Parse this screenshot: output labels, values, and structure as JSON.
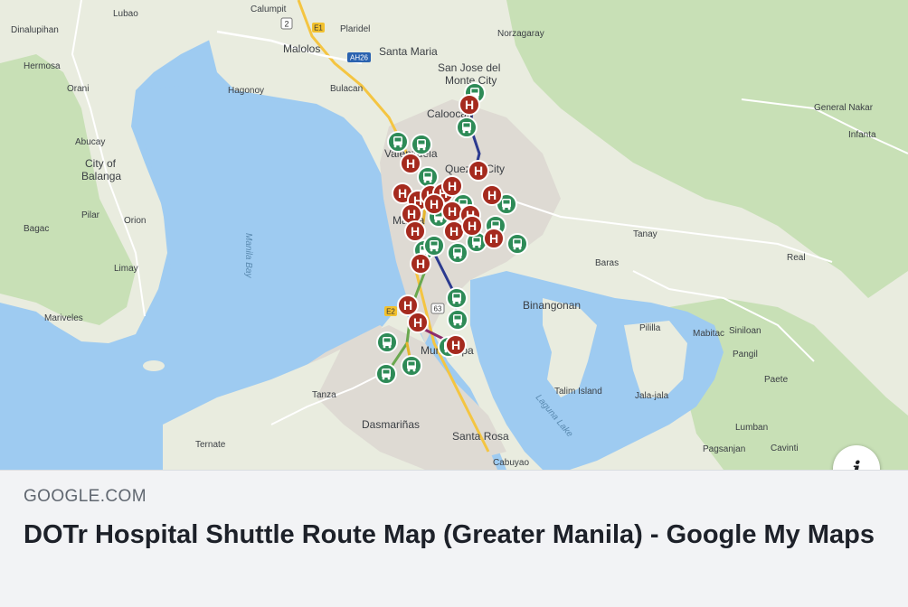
{
  "link_card": {
    "domain": "GOOGLE.COM",
    "title": "DOTr Hospital Shuttle Route Map (Greater Manila) - Google My Maps",
    "info_icon": "i"
  },
  "map": {
    "places": [
      {
        "id": "lubao",
        "label": "Lubao"
      },
      {
        "id": "calumpit",
        "label": "Calumpit"
      },
      {
        "id": "plaridel",
        "label": "Plaridel"
      },
      {
        "id": "norzagaray",
        "label": "Norzagaray"
      },
      {
        "id": "dinalupihan",
        "label": "Dinalupihan"
      },
      {
        "id": "malolos",
        "label": "Malolos"
      },
      {
        "id": "santa-maria",
        "label": "Santa Maria"
      },
      {
        "id": "hermosa",
        "label": "Hermosa"
      },
      {
        "id": "san-jose-del-monte",
        "label": "San Jose del"
      },
      {
        "id": "san-jose-del-monte-2",
        "label": "Monte City"
      },
      {
        "id": "orani",
        "label": "Orani"
      },
      {
        "id": "hagonoy",
        "label": "Hagonoy"
      },
      {
        "id": "bulacan",
        "label": "Bulacan"
      },
      {
        "id": "caloocan",
        "label": "Caloocan"
      },
      {
        "id": "general-nakar",
        "label": "General Nakar"
      },
      {
        "id": "infanta",
        "label": "Infanta"
      },
      {
        "id": "abucay",
        "label": "Abucay"
      },
      {
        "id": "city-of-balanga",
        "label": "City of"
      },
      {
        "id": "city-of-balanga-2",
        "label": "Balanga"
      },
      {
        "id": "valenzuela",
        "label": "Valenzuela"
      },
      {
        "id": "quezon-city",
        "label": "Quezon City"
      },
      {
        "id": "pilar",
        "label": "Pilar"
      },
      {
        "id": "orion",
        "label": "Orion"
      },
      {
        "id": "bagac",
        "label": "Bagac"
      },
      {
        "id": "manila",
        "label": "Manila"
      },
      {
        "id": "tanay",
        "label": "Tanay"
      },
      {
        "id": "limay",
        "label": "Limay"
      },
      {
        "id": "baras",
        "label": "Baras"
      },
      {
        "id": "real",
        "label": "Real"
      },
      {
        "id": "binangonan",
        "label": "Binangonan"
      },
      {
        "id": "mariveles",
        "label": "Mariveles"
      },
      {
        "id": "pililla",
        "label": "Pililla"
      },
      {
        "id": "mabitac",
        "label": "Mabitac"
      },
      {
        "id": "siniloan",
        "label": "Siniloan"
      },
      {
        "id": "pangil",
        "label": "Pangil"
      },
      {
        "id": "muntinlupa",
        "label": "Muntinlupa"
      },
      {
        "id": "paete",
        "label": "Paete"
      },
      {
        "id": "talim-island",
        "label": "Talim Island"
      },
      {
        "id": "jala-jala",
        "label": "Jala-jala"
      },
      {
        "id": "tanza",
        "label": "Tanza"
      },
      {
        "id": "dasmarinas",
        "label": "Dasmariñas"
      },
      {
        "id": "lumban",
        "label": "Lumban"
      },
      {
        "id": "santa-rosa",
        "label": "Santa Rosa"
      },
      {
        "id": "ternate",
        "label": "Ternate"
      },
      {
        "id": "pagsanjan",
        "label": "Pagsanjan"
      },
      {
        "id": "cavinti",
        "label": "Cavinti"
      },
      {
        "id": "cabuyao",
        "label": "Cabuyao"
      }
    ],
    "water_labels": [
      {
        "id": "manila-bay",
        "label": "Manila Bay"
      },
      {
        "id": "laguna-lake",
        "label": "Laguna Lake"
      }
    ],
    "road_shields": [
      {
        "id": "ah26",
        "label": "AH26"
      },
      {
        "id": "e1-north",
        "label": "E1"
      },
      {
        "id": "r2",
        "label": "2"
      },
      {
        "id": "r63",
        "label": "63"
      },
      {
        "id": "e2",
        "label": "E2"
      }
    ],
    "marker_letter": "H",
    "colors": {
      "water": "#9ecbf1",
      "land": "#e9ecdf",
      "green_area": "#c8e0b6",
      "urban": "#dedad3",
      "hospital_marker": "#a52a1e",
      "bus_marker": "#2e8b57",
      "route_blue": "#2b3a8f",
      "route_yellow": "#e5b52b",
      "route_green": "#6aa84f",
      "route_purple": "#8e2c6a"
    }
  }
}
